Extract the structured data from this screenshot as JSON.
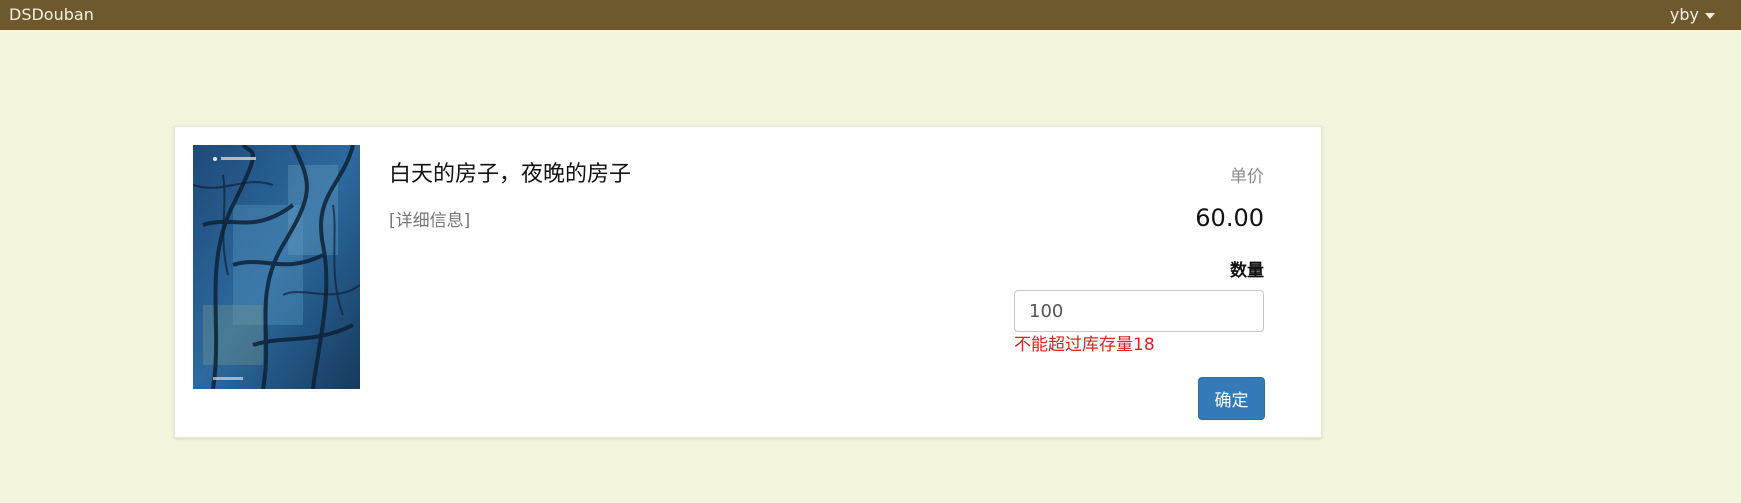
{
  "navbar": {
    "brand": "DSDouban",
    "user": "yby"
  },
  "book": {
    "title": "白天的房子，夜晚的房子",
    "details_link": "[详细信息]",
    "cover_title": "白天的房子，夜晚的房子"
  },
  "purchase": {
    "price_label": "单价",
    "price": "60.00",
    "quantity_label": "数量",
    "quantity_value": "100",
    "error": "不能超过库存量18",
    "confirm_label": "确定"
  },
  "colors": {
    "navbar_bg": "#6e582e",
    "page_bg": "#f5f4dc",
    "error": "#e02020",
    "primary_button": "#337ab7"
  }
}
